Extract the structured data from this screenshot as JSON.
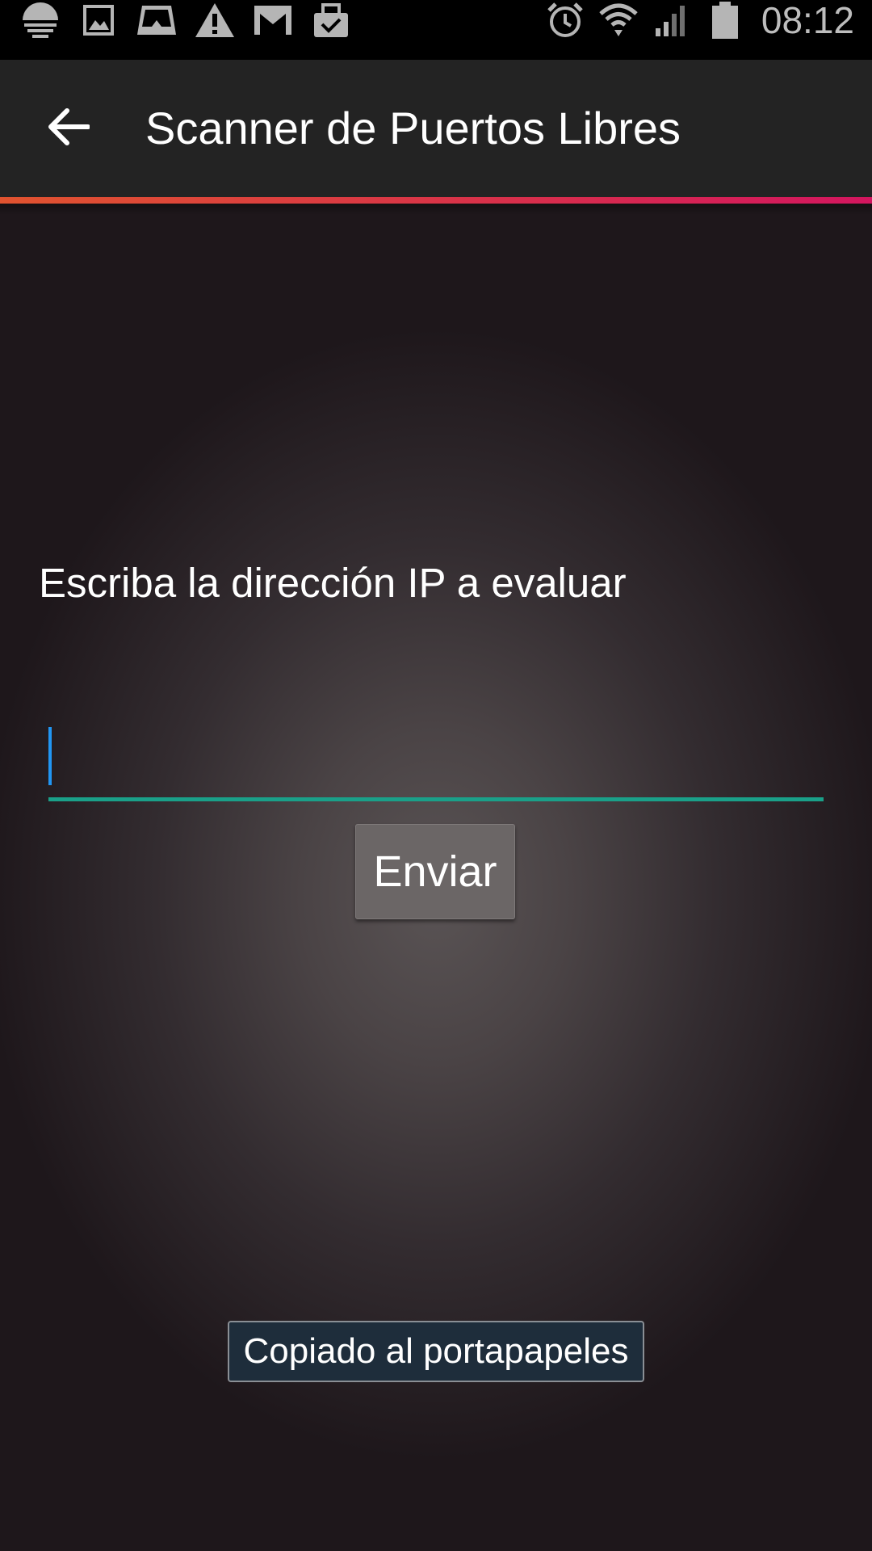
{
  "status_bar": {
    "time": "08:12",
    "left_icons": [
      "sync-icon",
      "image-icon",
      "inbox-icon",
      "warning-icon",
      "gmail-icon",
      "task-icon"
    ],
    "right_icons": [
      "alarm-icon",
      "wifi-icon",
      "signal-icon",
      "battery-icon"
    ]
  },
  "app_bar": {
    "back_icon": "arrow-back-icon",
    "title": "Scanner de Puertos Libres"
  },
  "colors": {
    "accent_gradient_start": "#e0532f",
    "accent_gradient_end": "#d3165f",
    "input_underline": "#1aa089",
    "cursor": "#2196f3",
    "toast_background": "#1e2d3b"
  },
  "main": {
    "prompt_label": "Escriba la dirección IP a evaluar",
    "ip_input_value": "",
    "send_button_label": "Enviar"
  },
  "toast": {
    "message": "Copiado al portapapeles"
  }
}
